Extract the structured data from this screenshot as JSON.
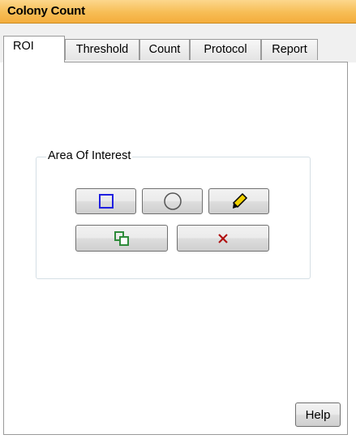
{
  "window": {
    "title": "Colony Count"
  },
  "tabs": [
    {
      "label": "ROI",
      "active": true
    },
    {
      "label": "Threshold",
      "active": false
    },
    {
      "label": "Count",
      "active": false
    },
    {
      "label": "Protocol",
      "active": false
    },
    {
      "label": "Report",
      "active": false
    }
  ],
  "roi_group": {
    "label": "Area Of Interest",
    "tools": [
      {
        "name": "rectangle-tool",
        "icon": "rectangle-icon",
        "color": "#2020e0"
      },
      {
        "name": "circle-tool",
        "icon": "circle-icon",
        "color": "#555555"
      },
      {
        "name": "freehand-tool",
        "icon": "pencil-icon",
        "color": "#000000"
      },
      {
        "name": "copy-roi",
        "icon": "overlapping-squares-icon",
        "color": "#2e8b3a"
      },
      {
        "name": "delete-roi",
        "icon": "x-mark-icon",
        "color": "#b01010"
      }
    ]
  },
  "footer": {
    "help_label": "Help"
  },
  "colors": {
    "title_bar": "#f7bd55",
    "tab_border": "#9a9a9a"
  }
}
